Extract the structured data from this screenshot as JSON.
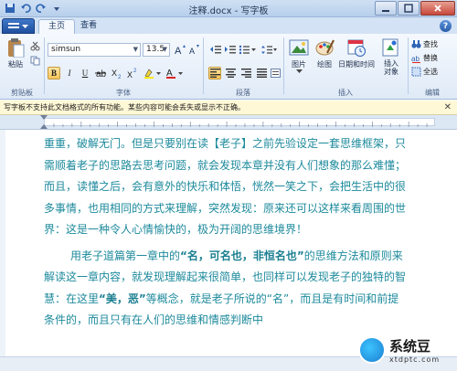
{
  "window": {
    "title": "注释.docx - 写字板"
  },
  "tabs": [
    "主页",
    "查看"
  ],
  "help": "?",
  "ribbon": {
    "clipboard": {
      "label": "剪贴板",
      "paste": "粘贴"
    },
    "font": {
      "label": "字体",
      "family": "simsun",
      "size": "13.5"
    },
    "paragraph": {
      "label": "段落"
    },
    "insert": {
      "label": "插入",
      "picture": "图片",
      "paint": "绘图",
      "datetime": "日期和时间",
      "object": "插入\n对象"
    },
    "edit": {
      "label": "编辑",
      "find": "查找",
      "replace": "替换",
      "selectall": "全选"
    }
  },
  "infobar": {
    "message": "写字板不支持此文档格式的所有功能。某些内容可能会丢失或显示不正确。"
  },
  "document": {
    "p1": "重重，破解无门。但是只要别在读【老子】之前先验设定一套思维框架，只需顺着老子的思路去思考问题，就会发现本章并没有人们想象的那么难懂；而且，读懂之后，会有意外的快乐和体悟，恍然一笑之下，会把生活中的很多事情，也用相同的方式来理解，突然发现：原来还可以这样来看周围的世界：这是一种令人心情愉快的，极为开阔的思维境界！",
    "p2_a": "用老子道篇第一章中的",
    "p2_b": "“名，可名也，非恒名也”",
    "p2_c": "的思维方法和原则来解读这一章内容，就发现理解起来很简单，也同样可以发现老子的独特的智慧：在这里",
    "p2_d": "“美，恶”",
    "p2_e": "等概念，就是老子所说的“名”，而且是有时间和前提条件的，而且只有在人们的思维和情感判断中"
  },
  "watermark": {
    "brand": "系统豆",
    "site": "xtdptc.com"
  }
}
